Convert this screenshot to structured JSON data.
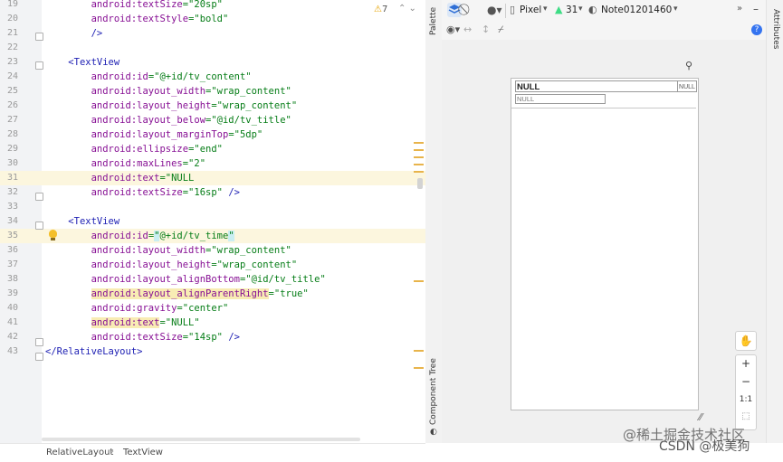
{
  "editor": {
    "lines": [
      {
        "num": "19",
        "tokens": [
          {
            "t": "        ",
            "c": "plain"
          },
          {
            "t": "android:",
            "c": "ns"
          },
          {
            "t": "textSize",
            "c": "ns"
          },
          {
            "t": "=\"20sp\"",
            "c": "val"
          }
        ]
      },
      {
        "num": "20",
        "tokens": [
          {
            "t": "        ",
            "c": "plain"
          },
          {
            "t": "android:",
            "c": "ns"
          },
          {
            "t": "textStyle",
            "c": "ns"
          },
          {
            "t": "=\"bold\"",
            "c": "val"
          }
        ]
      },
      {
        "num": "21",
        "tokens": [
          {
            "t": "        ",
            "c": "plain"
          },
          {
            "t": "/>",
            "c": "tag"
          }
        ]
      },
      {
        "num": "22",
        "tokens": []
      },
      {
        "num": "23",
        "tokens": [
          {
            "t": "    ",
            "c": "plain"
          },
          {
            "t": "<TextView",
            "c": "tag"
          }
        ]
      },
      {
        "num": "24",
        "tokens": [
          {
            "t": "        ",
            "c": "plain"
          },
          {
            "t": "android:",
            "c": "ns"
          },
          {
            "t": "id",
            "c": "ns"
          },
          {
            "t": "=\"@+id/tv_content\"",
            "c": "val"
          }
        ]
      },
      {
        "num": "25",
        "tokens": [
          {
            "t": "        ",
            "c": "plain"
          },
          {
            "t": "android:",
            "c": "ns"
          },
          {
            "t": "layout_width",
            "c": "ns"
          },
          {
            "t": "=\"wrap_content\"",
            "c": "val"
          }
        ]
      },
      {
        "num": "26",
        "tokens": [
          {
            "t": "        ",
            "c": "plain"
          },
          {
            "t": "android:",
            "c": "ns"
          },
          {
            "t": "layout_height",
            "c": "ns"
          },
          {
            "t": "=\"wrap_content\"",
            "c": "val"
          }
        ]
      },
      {
        "num": "27",
        "tokens": [
          {
            "t": "        ",
            "c": "plain"
          },
          {
            "t": "android:",
            "c": "ns"
          },
          {
            "t": "layout_below",
            "c": "ns"
          },
          {
            "t": "=\"@id/tv_title\"",
            "c": "val"
          }
        ]
      },
      {
        "num": "28",
        "tokens": [
          {
            "t": "        ",
            "c": "plain"
          },
          {
            "t": "android:",
            "c": "ns"
          },
          {
            "t": "layout_marginTop",
            "c": "ns"
          },
          {
            "t": "=\"5dp\"",
            "c": "val"
          }
        ]
      },
      {
        "num": "29",
        "tokens": [
          {
            "t": "        ",
            "c": "plain"
          },
          {
            "t": "android:",
            "c": "ns"
          },
          {
            "t": "ellipsize",
            "c": "ns"
          },
          {
            "t": "=\"end\"",
            "c": "val"
          }
        ]
      },
      {
        "num": "30",
        "tokens": [
          {
            "t": "        ",
            "c": "plain"
          },
          {
            "t": "android:",
            "c": "ns"
          },
          {
            "t": "maxLines",
            "c": "ns"
          },
          {
            "t": "=\"2\"",
            "c": "val"
          }
        ]
      },
      {
        "num": "31",
        "tokens": [
          {
            "t": "        ",
            "c": "plain"
          },
          {
            "t": "android:",
            "c": "ns"
          },
          {
            "t": "text",
            "c": "ns"
          },
          {
            "t": "=\"NULL",
            "c": "val"
          }
        ]
      },
      {
        "num": "32",
        "tokens": [
          {
            "t": "        ",
            "c": "plain"
          },
          {
            "t": "android:",
            "c": "ns"
          },
          {
            "t": "textSize",
            "c": "ns"
          },
          {
            "t": "=\"16sp\"",
            "c": "val"
          },
          {
            "t": " />",
            "c": "tag"
          }
        ]
      },
      {
        "num": "33",
        "tokens": []
      },
      {
        "num": "34",
        "tokens": [
          {
            "t": "    ",
            "c": "plain"
          },
          {
            "t": "<TextView",
            "c": "tag"
          }
        ]
      },
      {
        "num": "35",
        "tokens": [
          {
            "t": "        ",
            "c": "plain"
          },
          {
            "t": "android:",
            "c": "ns"
          },
          {
            "t": "id",
            "c": "ns"
          },
          {
            "t": "=",
            "c": "val"
          },
          {
            "t": "\"",
            "c": "idhl"
          },
          {
            "t": "@+id/tv_time",
            "c": "val"
          },
          {
            "t": "\"",
            "c": "idhl"
          }
        ]
      },
      {
        "num": "36",
        "tokens": [
          {
            "t": "        ",
            "c": "plain"
          },
          {
            "t": "android:",
            "c": "ns"
          },
          {
            "t": "layout_width",
            "c": "ns"
          },
          {
            "t": "=\"wrap_content\"",
            "c": "val"
          }
        ]
      },
      {
        "num": "37",
        "tokens": [
          {
            "t": "        ",
            "c": "plain"
          },
          {
            "t": "android:",
            "c": "ns"
          },
          {
            "t": "layout_height",
            "c": "ns"
          },
          {
            "t": "=\"wrap_content\"",
            "c": "val"
          }
        ]
      },
      {
        "num": "38",
        "tokens": [
          {
            "t": "        ",
            "c": "plain"
          },
          {
            "t": "android:",
            "c": "ns"
          },
          {
            "t": "layout_alignBottom",
            "c": "ns"
          },
          {
            "t": "=\"@id/tv_title\"",
            "c": "val"
          }
        ]
      },
      {
        "num": "39",
        "tokens": [
          {
            "t": "        ",
            "c": "plain"
          },
          {
            "t": "android:layout_alignParentRight",
            "c": "nshl"
          },
          {
            "t": "=\"true\"",
            "c": "val"
          }
        ]
      },
      {
        "num": "40",
        "tokens": [
          {
            "t": "        ",
            "c": "plain"
          },
          {
            "t": "android:",
            "c": "ns"
          },
          {
            "t": "gravity",
            "c": "ns"
          },
          {
            "t": "=\"center\"",
            "c": "val"
          }
        ]
      },
      {
        "num": "41",
        "tokens": [
          {
            "t": "        ",
            "c": "plain"
          },
          {
            "t": "android:text",
            "c": "nshl"
          },
          {
            "t": "=\"NULL\"",
            "c": "val"
          }
        ]
      },
      {
        "num": "42",
        "tokens": [
          {
            "t": "        ",
            "c": "plain"
          },
          {
            "t": "android:",
            "c": "ns"
          },
          {
            "t": "textSize",
            "c": "ns"
          },
          {
            "t": "=\"14sp\"",
            "c": "val"
          },
          {
            "t": " />",
            "c": "tag"
          }
        ]
      },
      {
        "num": "43",
        "tokens": [
          {
            "t": "</RelativeLayout>",
            "c": "tag"
          }
        ]
      }
    ],
    "warning_count": "7"
  },
  "breadcrumb": [
    "RelativeLayout",
    "TextView"
  ],
  "side_tabs": {
    "palette": "Palette",
    "component_tree": "Component Tree",
    "attributes": "Attributes"
  },
  "toolbar": {
    "device": "Pixel",
    "api": "31",
    "theme": "Note01201460"
  },
  "preview": {
    "title_text": "NULL",
    "time_text": "NULL",
    "content_text": "NULL"
  },
  "zoom": {
    "in": "+",
    "out": "−",
    "one_to_one": "1:1"
  },
  "watermark": {
    "line1": "@稀土掘金技术社区",
    "line2": "CSDN @极美狗"
  },
  "colors": {
    "tag": "#1d1fb3",
    "attr": "#871094",
    "value": "#067d17",
    "highlight": "#fcf6de"
  }
}
